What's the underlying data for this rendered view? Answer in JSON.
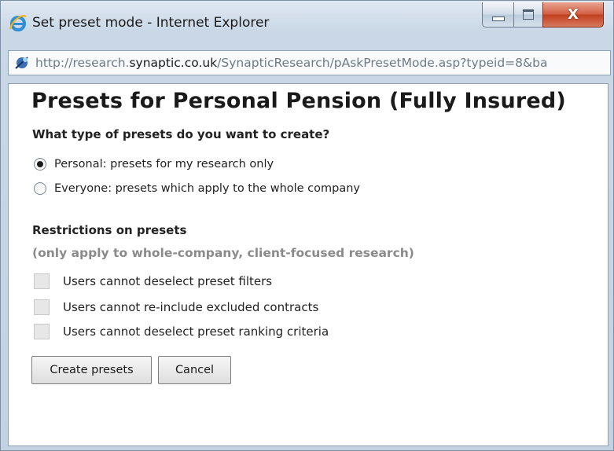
{
  "window": {
    "title": "Set preset mode - Internet Explorer",
    "address_prefix": "http://research.",
    "address_host": "synaptic.co.uk",
    "address_path": "/SynapticResearch/pAskPresetMode.asp?typeid=8&ba",
    "controls": {
      "minimize_icon": "minimize-icon",
      "maximize_icon": "maximize-icon",
      "close_label": "X"
    }
  },
  "page": {
    "title": "Presets for Personal Pension (Fully Insured)",
    "question": "What type of presets do you want to create?",
    "options": [
      {
        "label": "Personal: presets for my research only",
        "selected": true
      },
      {
        "label": "Everyone: presets which apply to the whole company",
        "selected": false
      }
    ],
    "restrictions_title": "Restrictions on presets",
    "restrictions_note": "(only apply to whole-company, client-focused research)",
    "restrictions": [
      {
        "label": "Users cannot deselect preset filters",
        "checked": false,
        "disabled": true
      },
      {
        "label": "Users cannot re-include excluded contracts",
        "checked": false,
        "disabled": true
      },
      {
        "label": "Users cannot deselect preset ranking criteria",
        "checked": false,
        "disabled": true
      }
    ],
    "buttons": {
      "create": "Create presets",
      "cancel": "Cancel"
    }
  },
  "colors": {
    "titlebar": "#c9d7e6",
    "close_button": "#c2401f",
    "content_bg": "#ffffff",
    "note_text": "#8a8a8a"
  }
}
